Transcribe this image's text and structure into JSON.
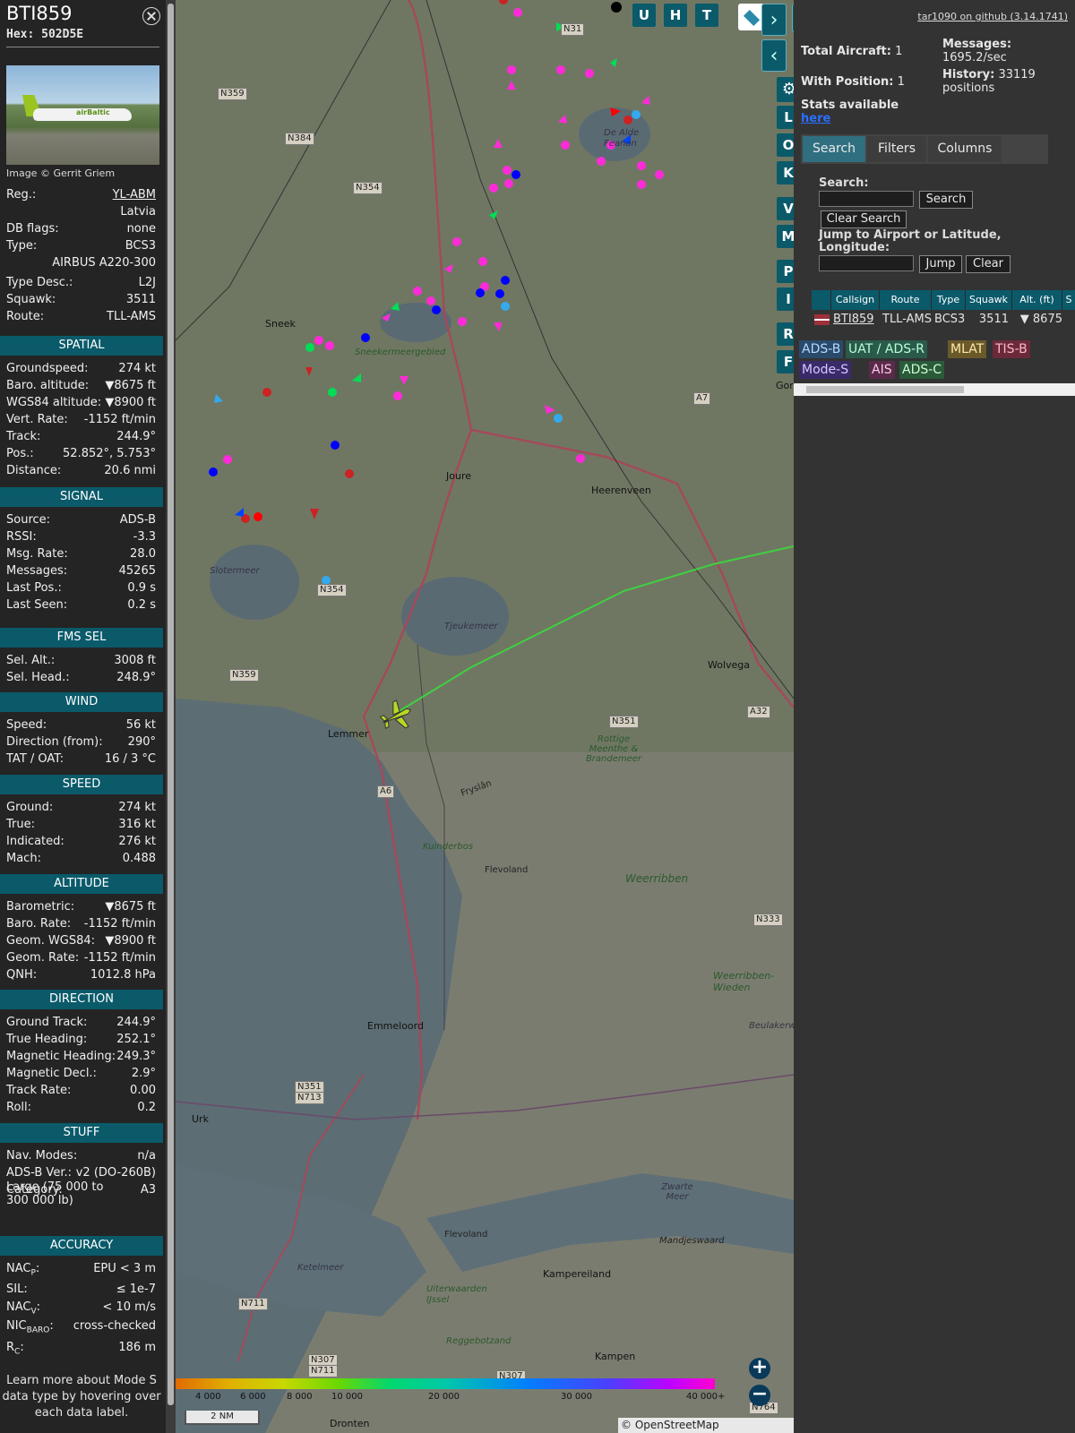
{
  "details": {
    "callsign": "BTI859",
    "hex_label": "Hex:",
    "hex": "502D5E",
    "photo_logo": "airBaltic",
    "image_credit": "Image © Gerrit Griem",
    "reg_label": "Reg.:",
    "reg": "YL-ABM",
    "country": "Latvia",
    "dbflags_label": "DB flags:",
    "dbflags": "none",
    "type_label": "Type:",
    "type": "BCS3",
    "type_full": "AIRBUS A220-300",
    "typedesc_label": "Type Desc.:",
    "typedesc": "L2J",
    "squawk_label": "Squawk:",
    "squawk": "3511",
    "route_label": "Route:",
    "route": "TLL-AMS",
    "learn_more": "Learn more about Mode S data type by hovering over each data label."
  },
  "sections": {
    "spatial": {
      "title": "SPATIAL",
      "rows": [
        {
          "k": "Groundspeed:",
          "v": "274 kt"
        },
        {
          "k": "Baro. altitude:",
          "v": "▼8675 ft"
        },
        {
          "k": "WGS84 altitude:",
          "v": "▼8900 ft"
        },
        {
          "k": "Vert. Rate:",
          "v": "-1152 ft/min"
        },
        {
          "k": "Track:",
          "v": "244.9°"
        },
        {
          "k": "Pos.:",
          "v": "52.852°, 5.753°"
        },
        {
          "k": "Distance:",
          "v": "20.6 nmi"
        }
      ]
    },
    "signal": {
      "title": "SIGNAL",
      "rows": [
        {
          "k": "Source:",
          "v": "ADS-B"
        },
        {
          "k": "RSSI:",
          "v": "-3.3"
        },
        {
          "k": "Msg. Rate:",
          "v": "28.0"
        },
        {
          "k": "Messages:",
          "v": "45265"
        },
        {
          "k": "Last Pos.:",
          "v": "0.9 s"
        },
        {
          "k": "Last Seen:",
          "v": "0.2 s"
        }
      ]
    },
    "fms": {
      "title": "FMS SEL",
      "rows": [
        {
          "k": "Sel. Alt.:",
          "v": "3008 ft"
        },
        {
          "k": "Sel. Head.:",
          "v": "248.9°"
        }
      ]
    },
    "wind": {
      "title": "WIND",
      "rows": [
        {
          "k": "Speed:",
          "v": "56 kt"
        },
        {
          "k": "Direction (from):",
          "v": "290°"
        },
        {
          "k": "TAT / OAT:",
          "v": "16 / 3 °C"
        }
      ]
    },
    "speed": {
      "title": "SPEED",
      "rows": [
        {
          "k": "Ground:",
          "v": "274 kt"
        },
        {
          "k": "True:",
          "v": "316 kt"
        },
        {
          "k": "Indicated:",
          "v": "276 kt"
        },
        {
          "k": "Mach:",
          "v": "0.488"
        }
      ]
    },
    "altitude": {
      "title": "ALTITUDE",
      "rows": [
        {
          "k": "Barometric:",
          "v": "▼8675 ft"
        },
        {
          "k": "Baro. Rate:",
          "v": "-1152 ft/min"
        },
        {
          "k": "Geom. WGS84:",
          "v": "▼8900 ft"
        },
        {
          "k": "Geom. Rate:",
          "v": "-1152 ft/min"
        },
        {
          "k": "QNH:",
          "v": "1012.8 hPa"
        }
      ]
    },
    "direction": {
      "title": "DIRECTION",
      "rows": [
        {
          "k": "Ground Track:",
          "v": "244.9°"
        },
        {
          "k": "True Heading:",
          "v": "252.1°"
        },
        {
          "k": "Magnetic Heading:",
          "v": "249.3°"
        },
        {
          "k": "Magnetic Decl.:",
          "v": "2.9°"
        },
        {
          "k": "Track Rate:",
          "v": "0.00"
        },
        {
          "k": "Roll:",
          "v": "0.2"
        }
      ]
    },
    "stuff": {
      "title": "STUFF",
      "rows": [
        {
          "k": "Nav. Modes:",
          "v": "n/a"
        },
        {
          "k": "ADS-B Ver.:",
          "v": "v2 (DO-260B)"
        },
        {
          "k": "Category:",
          "v": "A3"
        }
      ],
      "category_desc_1": "Large (75 000 to",
      "category_desc_2": "300 000 lb)"
    },
    "accuracy": {
      "title": "ACCURACY",
      "nacp": "NAC",
      "nacp_sub": "P",
      "nacp_v": "EPU < 3 m",
      "sil": "SIL:",
      "sil_v": "≤ 1e-7",
      "nacv": "NAC",
      "nacv_sub": "V",
      "nacv_v": "< 10 m/s",
      "nicbaro": "NIC",
      "nicbaro_sub": "BARO",
      "nicbaro_v": "cross-checked",
      "rc": "R",
      "rc_sub": "C",
      "rc_v": "186 m"
    }
  },
  "map": {
    "buttons": [
      "U",
      "H",
      "T"
    ],
    "side_buttons": [
      "L",
      "O",
      "K",
      "V",
      "M",
      "P",
      "I",
      "R",
      "F"
    ],
    "towns": {
      "sneek": "Sneek",
      "joure": "Joure",
      "heerenveen": "Heerenveen",
      "lemmer": "Lemmer",
      "wolvega": "Wolvega",
      "emmeloord": "Emmeloord",
      "urk": "Urk",
      "kampen": "Kampen",
      "dronten": "Dronten",
      "goor": "Gor",
      "kampereiland": "Kampereiland",
      "mandjeswaard": "Mandjeswaard"
    },
    "areas": {
      "sneekermeer": "Sneekermeergebied",
      "sloten": "Slotermeer",
      "tjeukemeer": "Tjeukemeer",
      "kuinderbos": "Kuinderbos",
      "weerribben": "Weerribben",
      "weerribben_wieden": "Weerribben-Wieden",
      "flevoland1": "Flevoland",
      "flevoland2": "Flevoland",
      "fryslan": "Fryslân",
      "rottige": "Rottige Meenthe & Brandemeer",
      "ketelmeer": "Ketelmeer",
      "uiterwaarden": "Uiterwaarden IJssel",
      "zwarte_meer": "Zwarte Meer",
      "alde_feanen": "De Alde Feanen",
      "beulakerwijde": "Beulakerwi",
      "reggebotzand": "Reggebotzand"
    },
    "roads": [
      "N31",
      "N359",
      "N384",
      "N354",
      "N354",
      "N359",
      "A7",
      "A6",
      "N351",
      "A32",
      "N351",
      "N713",
      "N333",
      "N711",
      "N307",
      "N711",
      "N307",
      "N764"
    ],
    "scale": "2 NM",
    "colorbar": [
      "4 000",
      "6 000",
      "8 000",
      "10 000",
      "20 000",
      "30 000",
      "40 000+"
    ],
    "attribution": "© OpenStreetMap contributors."
  },
  "right": {
    "github": "tar1090 on github (3.14.1741)",
    "total_label": "Total Aircraft:",
    "total": "1",
    "withpos_label": "With Position:",
    "withpos": "1",
    "messages_label": "Messages:",
    "messages_rate": "1695.2/sec",
    "history_label": "History:",
    "history": "33119",
    "history_unit": "positions",
    "stats_text": "Stats available",
    "stats_link": "here",
    "tabs": [
      "Search",
      "Filters",
      "Columns"
    ],
    "search_label": "Search:",
    "search_btn": "Search",
    "clear_search_btn": "Clear Search",
    "jump_label_1": "Jump to Airport or Latitude,",
    "jump_label_2": "Longitude:",
    "jump_btn": "Jump",
    "clear_btn": "Clear",
    "table_headers": [
      "Callsign",
      "Route",
      "Type",
      "Squawk",
      "Alt. (ft)",
      "S"
    ],
    "row": {
      "callsign": "BTI859",
      "route": "TLL-AMS",
      "type": "BCS3",
      "squawk": "3511",
      "alt": "▼ 8675"
    },
    "legend": [
      "ADS-B",
      "UAT / ADS-R",
      "MLAT",
      "TIS-B",
      "Mode-S",
      "AIS",
      "ADS-C"
    ],
    "legend_colors": [
      "#2a4a6a",
      "#2a5a4a",
      "#6a5a2a",
      "#6a2a3a",
      "#3a2a6a",
      "#5a2a4a",
      "#2a5a3a"
    ]
  }
}
